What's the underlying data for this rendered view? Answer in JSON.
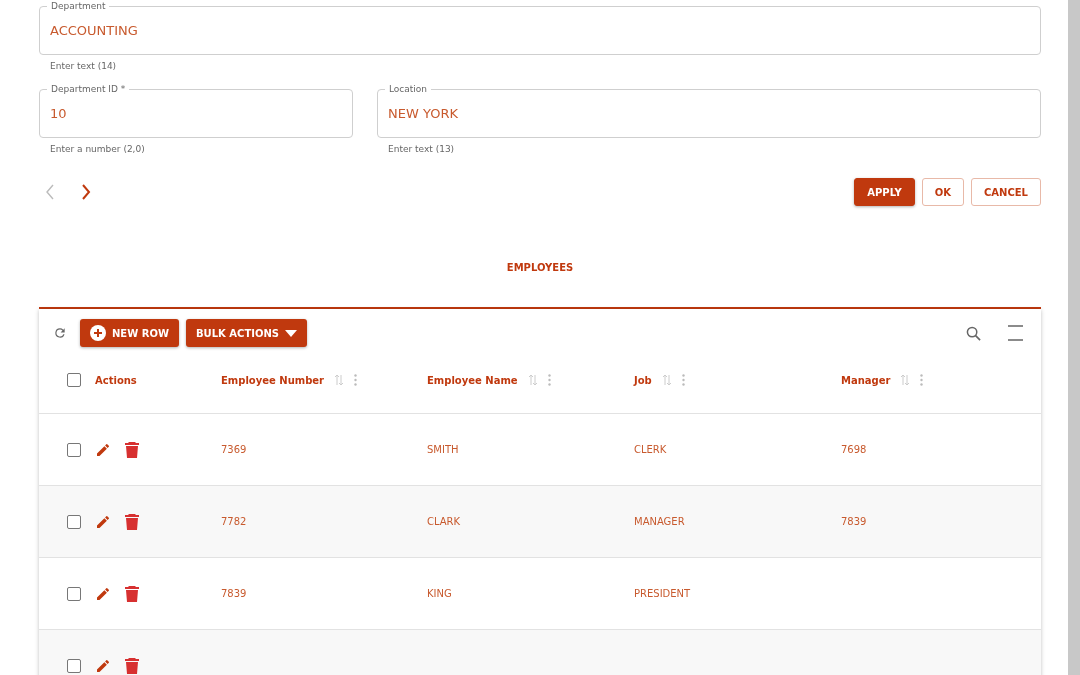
{
  "form": {
    "fields": [
      {
        "label": "Department",
        "value": "ACCOUNTING",
        "helper": "Enter text (14)"
      },
      {
        "label": "Department ID *",
        "value": "10",
        "helper": "Enter a number (2,0)"
      },
      {
        "label": "Location",
        "value": "NEW YORK",
        "helper": "Enter text (13)"
      }
    ],
    "pager": [
      {
        "kind": "prev",
        "disabled": true
      },
      {
        "kind": "next",
        "disabled": false
      }
    ],
    "buttons": [
      {
        "label": "APPLY",
        "kind": "primary"
      },
      {
        "label": "OK",
        "kind": "outline"
      },
      {
        "label": "CANCEL",
        "kind": "outline"
      }
    ]
  },
  "tabs": [
    {
      "label": "EMPLOYEES",
      "selected": true
    }
  ],
  "toolbar": {
    "buttons": [
      {
        "label": "NEW ROW",
        "kind": "add"
      },
      {
        "label": "BULK ACTIONS",
        "kind": "menu"
      }
    ]
  },
  "table": {
    "select_all": {
      "checked": false
    },
    "actions_label": "Actions",
    "columns": [
      "Employee Number",
      "Employee Name",
      "Job",
      "Manager"
    ],
    "rows": [
      {
        "checked": false,
        "cells": [
          "7369",
          "SMITH",
          "CLERK",
          "7698"
        ]
      },
      {
        "checked": false,
        "cells": [
          "7782",
          "CLARK",
          "MANAGER",
          "7839"
        ]
      },
      {
        "checked": false,
        "cells": [
          "7839",
          "KING",
          "PRESIDENT"
        ]
      },
      {
        "checked": false
      }
    ]
  }
}
